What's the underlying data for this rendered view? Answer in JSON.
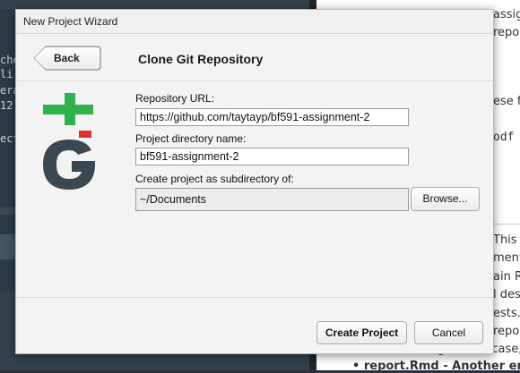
{
  "background": {
    "code_fragments": [
      "che",
      "li",
      "era",
      "12",
      "ect"
    ],
    "right_pane_fragments": [
      {
        "text": "assig",
        "mono": false
      },
      {
        "text": "repo",
        "mono": false
      },
      {
        "text": "ese f",
        "mono": false
      },
      {
        "text": "odf",
        "mono": true
      },
      {
        "text": "This",
        "mono": false
      },
      {
        "text": "ment,",
        "mono": false
      },
      {
        "text": "ain R",
        "mono": false
      },
      {
        "text": "l des",
        "mono": false
      },
      {
        "text": "ests.",
        "mono": false
      },
      {
        "text": "repos",
        "mono": false
      },
      {
        "text": "and licensing. In this case, i",
        "mono": false
      },
      {
        "text": "• report.Rmd - Another emp",
        "mono": false
      }
    ]
  },
  "dialog": {
    "title": "New Project Wizard",
    "back_label": "Back",
    "page_title": "Clone Git Repository",
    "logo_icon": "git-logo-icon",
    "logo_colors": {
      "plus": "#2fb24c",
      "bar": "#e2302c",
      "letters": "#3a4852"
    },
    "fields": {
      "repo_url": {
        "label": "Repository URL:",
        "value": "https://github.com/taytayp/bf591-assignment-2"
      },
      "dir_name": {
        "label": "Project directory name:",
        "value": "bf591-assignment-2"
      },
      "subdir": {
        "label": "Create project as subdirectory of:",
        "value": "~/Documents"
      }
    },
    "browse_label": "Browse...",
    "create_label": "Create Project",
    "cancel_label": "Cancel"
  }
}
